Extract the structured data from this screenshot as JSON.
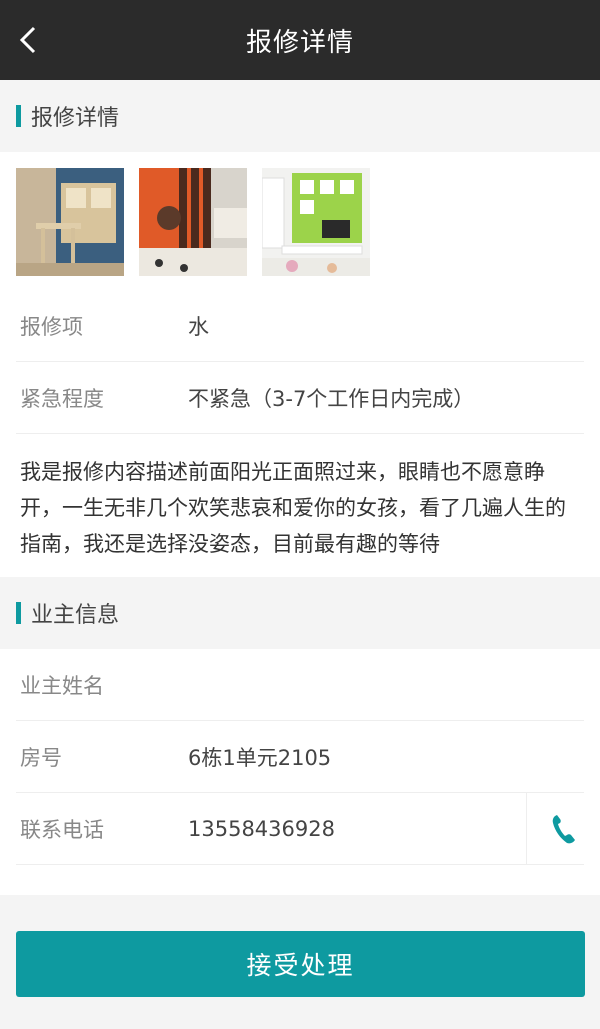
{
  "nav": {
    "title": "报修详情"
  },
  "repair_section": {
    "title": "报修详情"
  },
  "repair": {
    "item_label": "报修项",
    "item_value": "水",
    "urgency_label": "紧急程度",
    "urgency_value": "不紧急（3-7个工作日内完成）",
    "description": "我是报修内容描述前面阳光正面照过来，眼睛也不愿意睁开，一生无非几个欢笑悲哀和爱你的女孩，看了几遍人生的指南，我还是选择没姿态，目前最有趣的等待"
  },
  "owner_section": {
    "title": "业主信息"
  },
  "owner": {
    "name_label": "业主姓名",
    "name_value": "",
    "room_label": "房号",
    "room_value": "6栋1单元2105",
    "phone_label": "联系电话",
    "phone_value": "13558436928"
  },
  "actions": {
    "accept_label": "接受处理"
  },
  "colors": {
    "accent": "#0e9aa0",
    "nav_bg": "#2b2b2b"
  }
}
